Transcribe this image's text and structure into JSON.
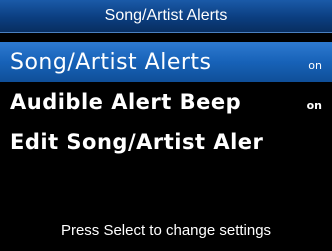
{
  "header": {
    "title": "Song/Artist Alerts"
  },
  "menu": {
    "items": [
      {
        "label": "Song/Artist Alerts",
        "value": "on",
        "selected": true
      },
      {
        "label": "Audible Alert Beep",
        "value": "on",
        "selected": false
      },
      {
        "label": "Edit Song/Artist Aler",
        "value": "",
        "selected": false
      }
    ]
  },
  "footer": {
    "hint": "Press Select to change settings"
  },
  "colors": {
    "background": "#000000",
    "title_bar": "#0b3e80",
    "selection": "#1762b8",
    "text": "#ffffff"
  }
}
